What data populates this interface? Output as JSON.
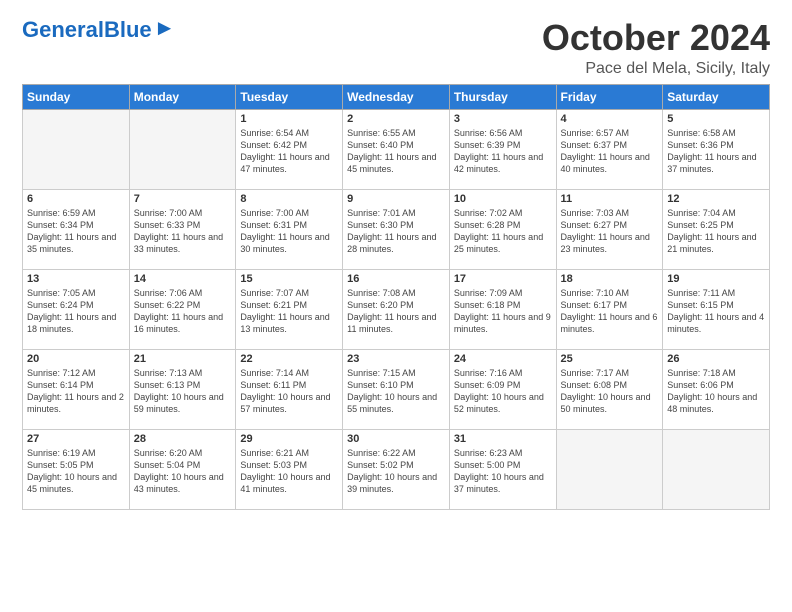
{
  "header": {
    "logo_general": "General",
    "logo_blue": "Blue",
    "title": "October 2024",
    "subtitle": "Pace del Mela, Sicily, Italy"
  },
  "weekdays": [
    "Sunday",
    "Monday",
    "Tuesday",
    "Wednesday",
    "Thursday",
    "Friday",
    "Saturday"
  ],
  "weeks": [
    [
      {
        "day": "",
        "info": ""
      },
      {
        "day": "",
        "info": ""
      },
      {
        "day": "1",
        "info": "Sunrise: 6:54 AM\nSunset: 6:42 PM\nDaylight: 11 hours and 47 minutes."
      },
      {
        "day": "2",
        "info": "Sunrise: 6:55 AM\nSunset: 6:40 PM\nDaylight: 11 hours and 45 minutes."
      },
      {
        "day": "3",
        "info": "Sunrise: 6:56 AM\nSunset: 6:39 PM\nDaylight: 11 hours and 42 minutes."
      },
      {
        "day": "4",
        "info": "Sunrise: 6:57 AM\nSunset: 6:37 PM\nDaylight: 11 hours and 40 minutes."
      },
      {
        "day": "5",
        "info": "Sunrise: 6:58 AM\nSunset: 6:36 PM\nDaylight: 11 hours and 37 minutes."
      }
    ],
    [
      {
        "day": "6",
        "info": "Sunrise: 6:59 AM\nSunset: 6:34 PM\nDaylight: 11 hours and 35 minutes."
      },
      {
        "day": "7",
        "info": "Sunrise: 7:00 AM\nSunset: 6:33 PM\nDaylight: 11 hours and 33 minutes."
      },
      {
        "day": "8",
        "info": "Sunrise: 7:00 AM\nSunset: 6:31 PM\nDaylight: 11 hours and 30 minutes."
      },
      {
        "day": "9",
        "info": "Sunrise: 7:01 AM\nSunset: 6:30 PM\nDaylight: 11 hours and 28 minutes."
      },
      {
        "day": "10",
        "info": "Sunrise: 7:02 AM\nSunset: 6:28 PM\nDaylight: 11 hours and 25 minutes."
      },
      {
        "day": "11",
        "info": "Sunrise: 7:03 AM\nSunset: 6:27 PM\nDaylight: 11 hours and 23 minutes."
      },
      {
        "day": "12",
        "info": "Sunrise: 7:04 AM\nSunset: 6:25 PM\nDaylight: 11 hours and 21 minutes."
      }
    ],
    [
      {
        "day": "13",
        "info": "Sunrise: 7:05 AM\nSunset: 6:24 PM\nDaylight: 11 hours and 18 minutes."
      },
      {
        "day": "14",
        "info": "Sunrise: 7:06 AM\nSunset: 6:22 PM\nDaylight: 11 hours and 16 minutes."
      },
      {
        "day": "15",
        "info": "Sunrise: 7:07 AM\nSunset: 6:21 PM\nDaylight: 11 hours and 13 minutes."
      },
      {
        "day": "16",
        "info": "Sunrise: 7:08 AM\nSunset: 6:20 PM\nDaylight: 11 hours and 11 minutes."
      },
      {
        "day": "17",
        "info": "Sunrise: 7:09 AM\nSunset: 6:18 PM\nDaylight: 11 hours and 9 minutes."
      },
      {
        "day": "18",
        "info": "Sunrise: 7:10 AM\nSunset: 6:17 PM\nDaylight: 11 hours and 6 minutes."
      },
      {
        "day": "19",
        "info": "Sunrise: 7:11 AM\nSunset: 6:15 PM\nDaylight: 11 hours and 4 minutes."
      }
    ],
    [
      {
        "day": "20",
        "info": "Sunrise: 7:12 AM\nSunset: 6:14 PM\nDaylight: 11 hours and 2 minutes."
      },
      {
        "day": "21",
        "info": "Sunrise: 7:13 AM\nSunset: 6:13 PM\nDaylight: 10 hours and 59 minutes."
      },
      {
        "day": "22",
        "info": "Sunrise: 7:14 AM\nSunset: 6:11 PM\nDaylight: 10 hours and 57 minutes."
      },
      {
        "day": "23",
        "info": "Sunrise: 7:15 AM\nSunset: 6:10 PM\nDaylight: 10 hours and 55 minutes."
      },
      {
        "day": "24",
        "info": "Sunrise: 7:16 AM\nSunset: 6:09 PM\nDaylight: 10 hours and 52 minutes."
      },
      {
        "day": "25",
        "info": "Sunrise: 7:17 AM\nSunset: 6:08 PM\nDaylight: 10 hours and 50 minutes."
      },
      {
        "day": "26",
        "info": "Sunrise: 7:18 AM\nSunset: 6:06 PM\nDaylight: 10 hours and 48 minutes."
      }
    ],
    [
      {
        "day": "27",
        "info": "Sunrise: 6:19 AM\nSunset: 5:05 PM\nDaylight: 10 hours and 45 minutes."
      },
      {
        "day": "28",
        "info": "Sunrise: 6:20 AM\nSunset: 5:04 PM\nDaylight: 10 hours and 43 minutes."
      },
      {
        "day": "29",
        "info": "Sunrise: 6:21 AM\nSunset: 5:03 PM\nDaylight: 10 hours and 41 minutes."
      },
      {
        "day": "30",
        "info": "Sunrise: 6:22 AM\nSunset: 5:02 PM\nDaylight: 10 hours and 39 minutes."
      },
      {
        "day": "31",
        "info": "Sunrise: 6:23 AM\nSunset: 5:00 PM\nDaylight: 10 hours and 37 minutes."
      },
      {
        "day": "",
        "info": ""
      },
      {
        "day": "",
        "info": ""
      }
    ]
  ]
}
